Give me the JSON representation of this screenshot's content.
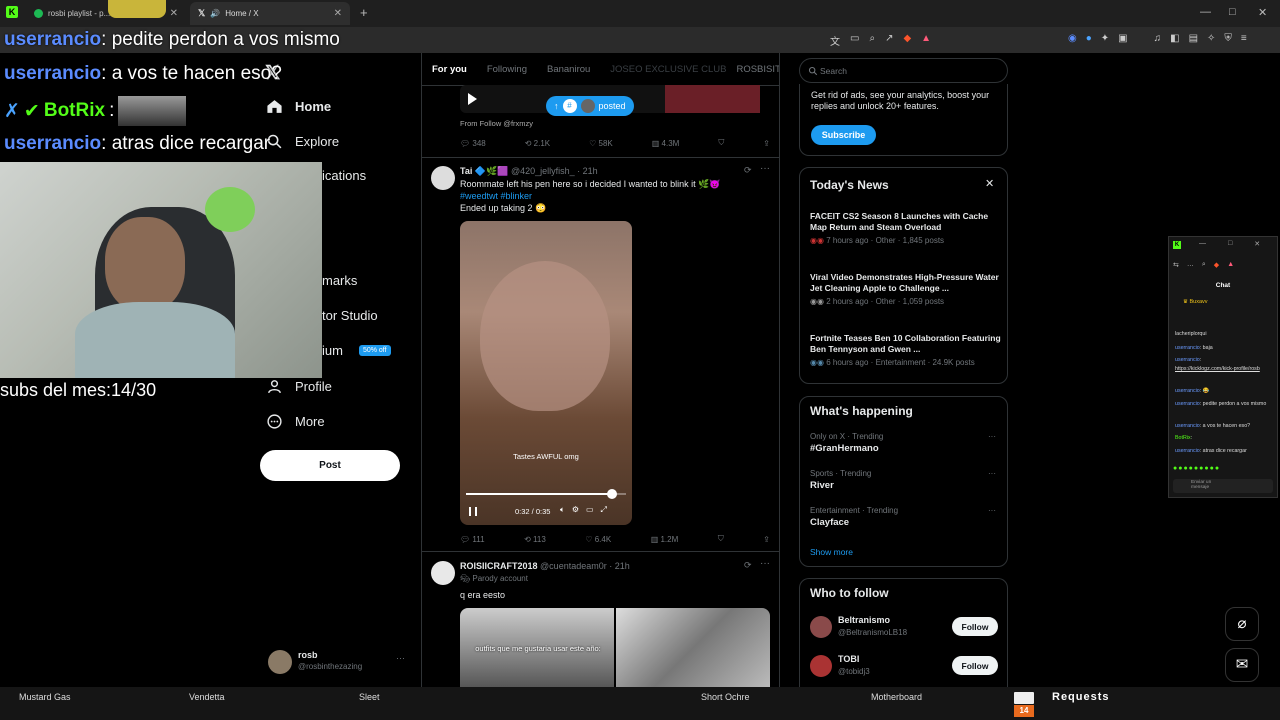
{
  "browser": {
    "tabs": [
      {
        "title": "rosbi playlist - p...",
        "active": false
      },
      {
        "title": "Home / X",
        "active": true
      }
    ],
    "new_tab": "+",
    "window_controls": [
      "—",
      "□",
      "✕"
    ]
  },
  "overlay": {
    "chat": [
      {
        "user": "userrancio",
        "text": ": pedite perdon a vos mismo"
      },
      {
        "user": "userrancio",
        "text": ": a vos te hacen eso?"
      },
      {
        "user": "BotRix",
        "text": ":"
      },
      {
        "user": "userrancio",
        "text": ": atras dice recargar"
      }
    ],
    "subs": "subs del mes:14/30"
  },
  "nav": {
    "items": [
      {
        "label": "Home"
      },
      {
        "label": "Explore"
      },
      {
        "label": "ications"
      },
      {
        "label": "marks"
      },
      {
        "label": "tor Studio"
      },
      {
        "label": "ium"
      },
      {
        "label": "Profile"
      },
      {
        "label": "More"
      }
    ],
    "premium_badge": "50% off",
    "post_button": "Post",
    "account": {
      "name": "rosb",
      "handle": "@rosbinthezazing",
      "more": "···"
    }
  },
  "feed": {
    "tabs": [
      "For you",
      "Following",
      "Bananirou",
      "JOSEO EXCLUSIVE CLUB",
      "ROSBISITOS"
    ],
    "posted_pill": "posted",
    "post0": {
      "follow_text": "From Follow @frxmzy",
      "stats": [
        "348",
        "2.1K",
        "58K",
        "4.3M"
      ]
    },
    "post1": {
      "author": "Tai",
      "handle": "@420_jellyfish_ · 21h",
      "text1": "Roommate left his pen here so i decided I wanted to blink it",
      "hashtags": "#weedtwt #blinker",
      "text2": "Ended up taking 2",
      "caption": "Tastes AWFUL omg",
      "time": "0:32 / 0:35",
      "progress": 0.91,
      "stats": [
        "111",
        "113",
        "6.4K",
        "1.2M"
      ]
    },
    "post2": {
      "author": "ROISIICRAFT2018",
      "handle": "@cuentadeam0r · 21h",
      "parody": "Parody account",
      "text": "q era eesto",
      "img_caption": "outfits que me gustaria usar este año:"
    }
  },
  "right": {
    "search_placeholder": "Search",
    "premium_text": "Get rid of ads, see your analytics, boost your replies and unlock 20+ features.",
    "subscribe": "Subscribe",
    "news_title": "Today's News",
    "news": [
      {
        "title": "FACEIT CS2 Season 8 Launches with Cache Map Return and Steam Overload",
        "meta": "7 hours ago · Other · 1,845 posts"
      },
      {
        "title": "Viral Video Demonstrates High-Pressure Water Jet Cleaning Apple to Challenge ...",
        "meta": "2 hours ago · Other · 1,059 posts"
      },
      {
        "title": "Fortnite Teases Ben 10 Collaboration Featuring Ben Tennyson and Gwen ...",
        "meta": "6 hours ago · Entertainment · 24.9K posts"
      }
    ],
    "happening_title": "What's happening",
    "trends": [
      {
        "context": "Only on X · Trending",
        "name": "#GranHermano"
      },
      {
        "context": "Sports · Trending",
        "name": "River"
      },
      {
        "context": "Entertainment · Trending",
        "name": "Clayface"
      }
    ],
    "show_more": "Show more",
    "who_title": "Who to follow",
    "who": [
      {
        "name": "Beltranismo",
        "handle": "@BeltranismoLB18",
        "btn": "Follow"
      },
      {
        "name": "TOBI",
        "handle": "@tobidj3",
        "btn": "Follow"
      }
    ]
  },
  "popup": {
    "title": "Chat",
    "user": "Buxavv",
    "lines": [
      {
        "user": "",
        "text": "lacheriplorqui"
      },
      {
        "user": "userrancio",
        "text": ": baja"
      },
      {
        "user": "userrancio",
        "text": ":"
      },
      {
        "user": "",
        "text": "https://kicklogz.com/kick-profile/rosb"
      },
      {
        "user": "userrancio",
        "text": ":"
      },
      {
        "user": "userrancio",
        "text": ": pedite perdon a vos mismo"
      },
      {
        "user": "userrancio",
        "text": ": a vos te hacen eso?"
      },
      {
        "user": "BotRix",
        "text": ":"
      },
      {
        "user": "userrancio",
        "text": ": atras dice recargar"
      }
    ],
    "send_label": "Enviar un mensaje"
  },
  "taskbar": {
    "labels": [
      "Mustard Gas",
      "Vendetta",
      "Sleet",
      "Short Ochre",
      "Motherboard"
    ],
    "requests_label": "Requests",
    "requests_count": "14"
  },
  "colors": {
    "accent": "#1d9bf0",
    "kick_green": "#53fc18",
    "chat_user": "#5b8cff"
  }
}
